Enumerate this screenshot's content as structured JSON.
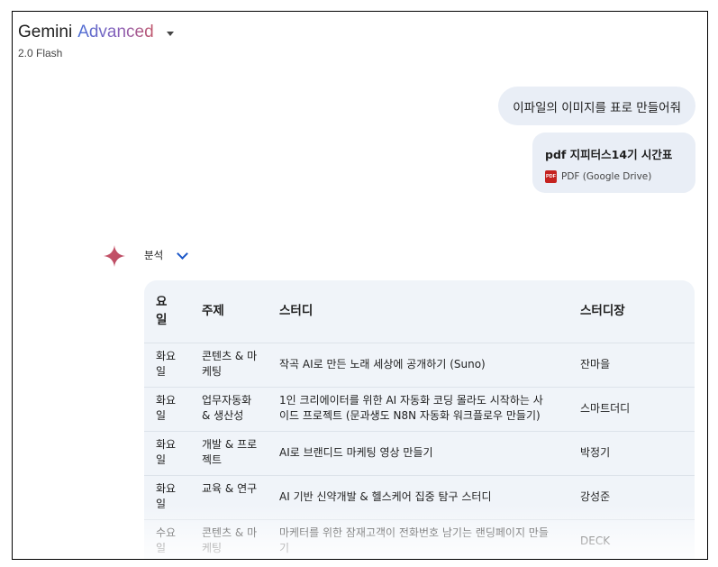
{
  "header": {
    "brand": "Gemini",
    "tier": "Advanced",
    "model": "2.0 Flash"
  },
  "conversation": {
    "user_message": "이파일의 이미지를 표로 만들어줘",
    "attachment": {
      "name": "pdf 지피터스14기 시간표",
      "type_label": "PDF (Google Drive)",
      "icon_text": "PDF"
    },
    "analysis_label": "분석"
  },
  "table": {
    "headers": {
      "day": "요일",
      "topic": "주제",
      "study": "스터디",
      "leader": "스터디장"
    },
    "rows": [
      {
        "day": "화요일",
        "topic": "콘텐츠 & 마케팅",
        "study": "작곡 AI로 만든 노래 세상에 공개하기 (Suno)",
        "leader": "잔마을"
      },
      {
        "day": "화요일",
        "topic": "업무자동화 & 생산성",
        "study": "1인 크리에이터를 위한 AI 자동화 코딩 몰라도 시작하는 사이드 프로젝트 (문과생도 N8N 자동화 워크플로우 만들기)",
        "leader": "스마트더디"
      },
      {
        "day": "화요일",
        "topic": "개발 & 프로젝트",
        "study": "AI로 브랜디드 마케팅 영상 만들기",
        "leader": "박정기"
      },
      {
        "day": "화요일",
        "topic": "교육 & 연구",
        "study": "AI 기반 신약개발 & 헬스케어 집중 탐구 스터디",
        "leader": "강성준"
      },
      {
        "day": "수요일",
        "topic": "콘텐츠 & 마케팅",
        "study": "마케터를 위한 잠재고객이 전화번호 남기는 랜딩페이지 만들기",
        "leader": "DECK"
      }
    ]
  },
  "colors": {
    "bubble": "#e9eef6",
    "table_bg": "#f0f4f9",
    "accent_blue": "#1a56c8",
    "pdf_red": "#c5221f"
  }
}
